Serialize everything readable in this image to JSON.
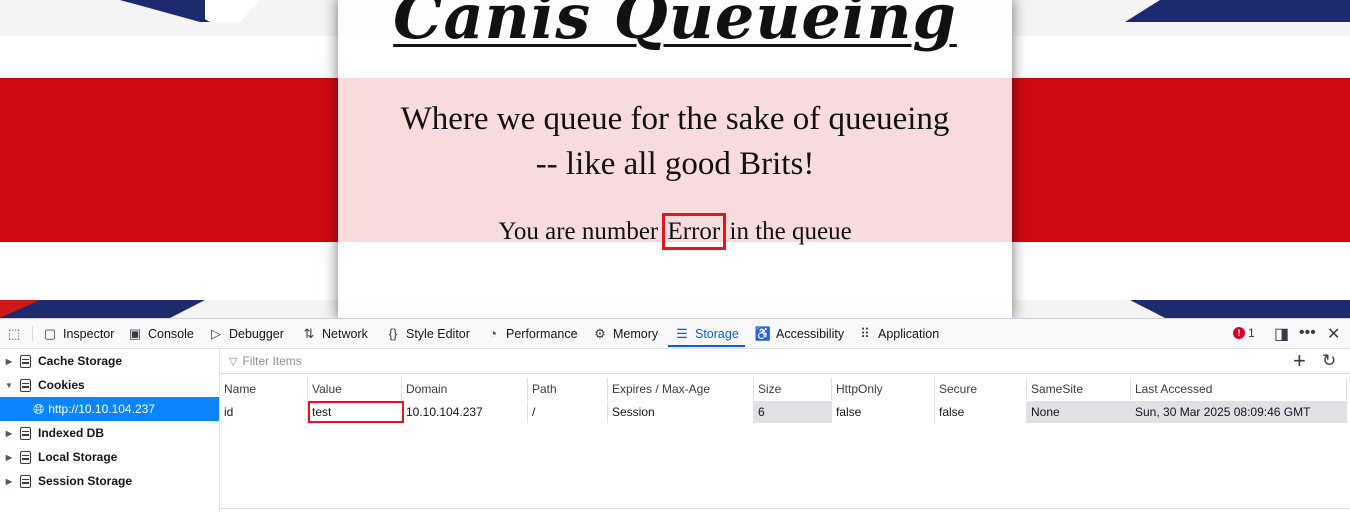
{
  "page": {
    "title": "Canis Queueing",
    "tagline_line1": "Where we queue for the sake of queueing",
    "tagline_line2": "-- like all good Brits!",
    "queue_prefix": "You are number",
    "queue_value": "Error",
    "queue_suffix": "in the queue"
  },
  "devtools": {
    "tabs": [
      {
        "label": "Inspector",
        "icon": "inspector-icon"
      },
      {
        "label": "Console",
        "icon": "console-icon"
      },
      {
        "label": "Debugger",
        "icon": "debugger-icon"
      },
      {
        "label": "Network",
        "icon": "network-icon"
      },
      {
        "label": "Style Editor",
        "icon": "style-editor-icon"
      },
      {
        "label": "Performance",
        "icon": "performance-icon"
      },
      {
        "label": "Memory",
        "icon": "memory-icon"
      },
      {
        "label": "Storage",
        "icon": "storage-icon",
        "selected": true
      },
      {
        "label": "Accessibility",
        "icon": "accessibility-icon"
      },
      {
        "label": "Application",
        "icon": "application-icon"
      }
    ],
    "error_count": "1",
    "sidebar": {
      "items": [
        {
          "label": "Cache Storage",
          "expanded": false
        },
        {
          "label": "Cookies",
          "expanded": true
        },
        {
          "label": "http://10.10.104.237",
          "selected": true
        },
        {
          "label": "Indexed DB",
          "expanded": false
        },
        {
          "label": "Local Storage",
          "expanded": false
        },
        {
          "label": "Session Storage",
          "expanded": false
        }
      ]
    },
    "filter_placeholder": "Filter Items",
    "table": {
      "headers": [
        "Name",
        "Value",
        "Domain",
        "Path",
        "Expires / Max-Age",
        "Size",
        "HttpOnly",
        "Secure",
        "SameSite",
        "Last Accessed"
      ],
      "rows": [
        [
          "id",
          "test",
          "10.10.104.237",
          "/",
          "Session",
          "6",
          "false",
          "false",
          "None",
          "Sun, 30 Mar 2025 08:09:46 GMT"
        ]
      ]
    },
    "colors": {
      "accent": "#0060df",
      "selection": "#0a84ff",
      "highlight": "#e8141b"
    }
  }
}
